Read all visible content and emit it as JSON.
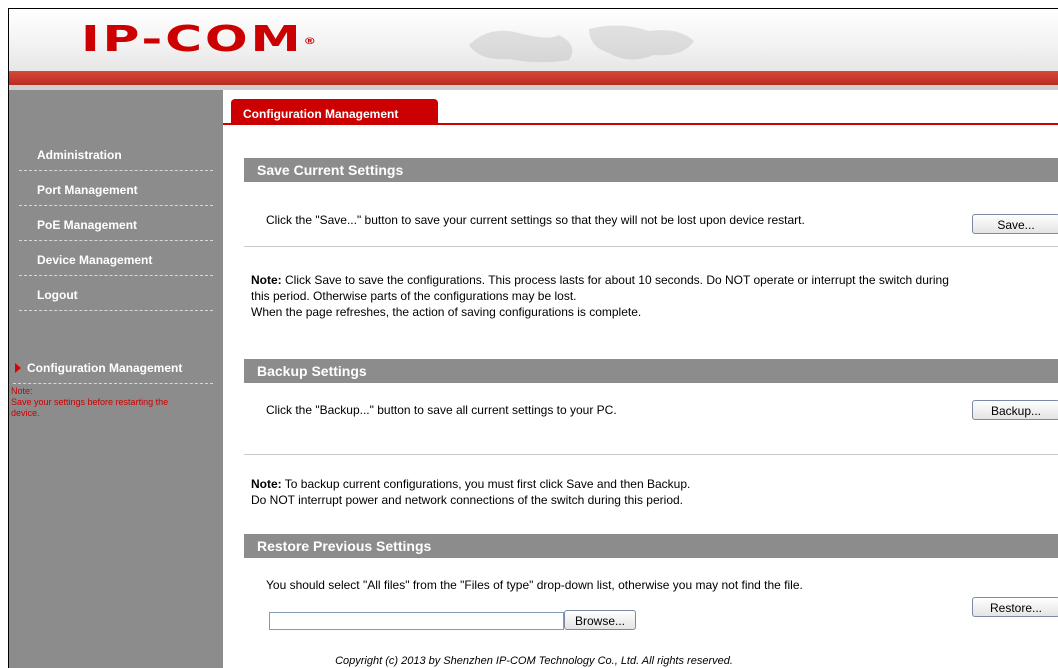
{
  "header": {
    "logo": "IP-COM",
    "logo_mark": "®"
  },
  "sidebar": {
    "items": [
      {
        "label": "Administration",
        "active": false
      },
      {
        "label": "Port Management",
        "active": false
      },
      {
        "label": "PoE Management",
        "active": false
      },
      {
        "label": "Device Management",
        "active": false
      },
      {
        "label": "Logout",
        "active": false
      },
      {
        "label": "Configuration Management",
        "active": true
      }
    ],
    "note_title": "Note:",
    "note_text": "Save your settings before restarting the device."
  },
  "tab": {
    "label": "Configuration Management"
  },
  "save": {
    "title": "Save Current Settings",
    "description": "Click the \"Save...\" button to save your current settings so that they will not be lost upon device restart.",
    "button": "Save...",
    "note_label": "Note:",
    "note_line1": " Click Save to save the configurations. This process lasts for about 10 seconds. Do NOT operate or interrupt the switch during",
    "note_line2": "this period. Otherwise parts of the configurations may be lost.",
    "note_line3": "When the page refreshes, the action of saving configurations is complete."
  },
  "backup": {
    "title": "Backup Settings",
    "description": "Click the \"Backup...\" button to save all current settings to your PC.",
    "button": "Backup...",
    "note_label": "Note:",
    "note_line1": " To backup current configurations, you must first click Save and then Backup.",
    "note_line2": "Do NOT interrupt power and network connections of the switch during this period."
  },
  "restore": {
    "title": "Restore Previous Settings",
    "description": "You should select \"All files\" from the \"Files of type\" drop-down list, otherwise you may not find the file.",
    "file_value": "",
    "browse_button": "Browse...",
    "button": "Restore..."
  },
  "footer": {
    "copyright": "Copyright (c) 2013 by Shenzhen IP-COM Technology Co., Ltd. All rights reserved."
  },
  "colors": {
    "brand_red": "#cc0000",
    "sidebar_grey": "#8c8c8c"
  }
}
